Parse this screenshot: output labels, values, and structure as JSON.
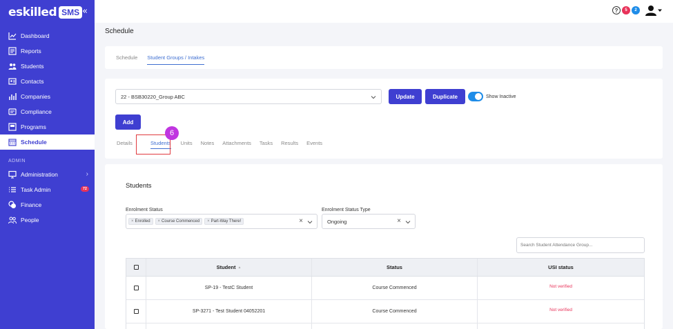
{
  "brand": {
    "logo_text": "eskilled",
    "logo_sms": "SMS"
  },
  "sidebar": {
    "items": [
      {
        "label": "Dashboard",
        "icon": "chart-line-icon"
      },
      {
        "label": "Reports",
        "icon": "report-icon"
      },
      {
        "label": "Students",
        "icon": "users-icon"
      },
      {
        "label": "Contacts",
        "icon": "contact-card-icon"
      },
      {
        "label": "Companies",
        "icon": "bar-chart-icon"
      },
      {
        "label": "Compliance",
        "icon": "compliance-icon"
      },
      {
        "label": "Programs",
        "icon": "program-icon"
      },
      {
        "label": "Schedule",
        "icon": "calendar-icon",
        "active": true
      }
    ],
    "admin_section": "ADMIN",
    "admin_items": [
      {
        "label": "Administration",
        "icon": "monitor-icon"
      },
      {
        "label": "Task Admin",
        "icon": "list-icon",
        "badge": "72"
      },
      {
        "label": "Finance",
        "icon": "coins-icon"
      },
      {
        "label": "People",
        "icon": "people-icon"
      }
    ]
  },
  "topbar": {
    "help": "?",
    "badge_red": "5",
    "badge_blue": "2"
  },
  "page": {
    "title": "Schedule"
  },
  "tabs": [
    "Schedule",
    "Student Groups / Intakes"
  ],
  "group": {
    "selected": "22 - BSB30220_Group ABC",
    "update_label": "Update",
    "duplicate_label": "Duplicate",
    "show_inactive_label": "Show Inactive",
    "add_label": "Add"
  },
  "subtabs": [
    "Details",
    "Students",
    "Units",
    "Notes",
    "Attachments",
    "Tasks",
    "Results",
    "Events"
  ],
  "step_number": "6",
  "students": {
    "title": "Students",
    "enrolment_status_label": "Enrolment Status",
    "enrolment_chips": [
      "Enrolled",
      "Course Commenced",
      "Part-Way There!"
    ],
    "status_type_label": "Enrolment Status Type",
    "status_type_value": "Ongoing",
    "search_placeholder": "Search Student Attendance Group...",
    "columns": {
      "student": "Student",
      "status": "Status",
      "usi": "USI status"
    },
    "sort_indicator": "▲",
    "rows": [
      {
        "student": "SP-19 - TestC Student",
        "status": "Course Commenced",
        "usi": "Not verified"
      },
      {
        "student": "SP-3271 - Test Student 04052201",
        "status": "Course Commenced",
        "usi": "Not verified"
      }
    ]
  },
  "colors": {
    "primary": "#3f3fd1",
    "accent_blue": "#1e8ce8",
    "danger": "#e8335a",
    "step": "#c035e0",
    "highlight": "#e0393e"
  }
}
